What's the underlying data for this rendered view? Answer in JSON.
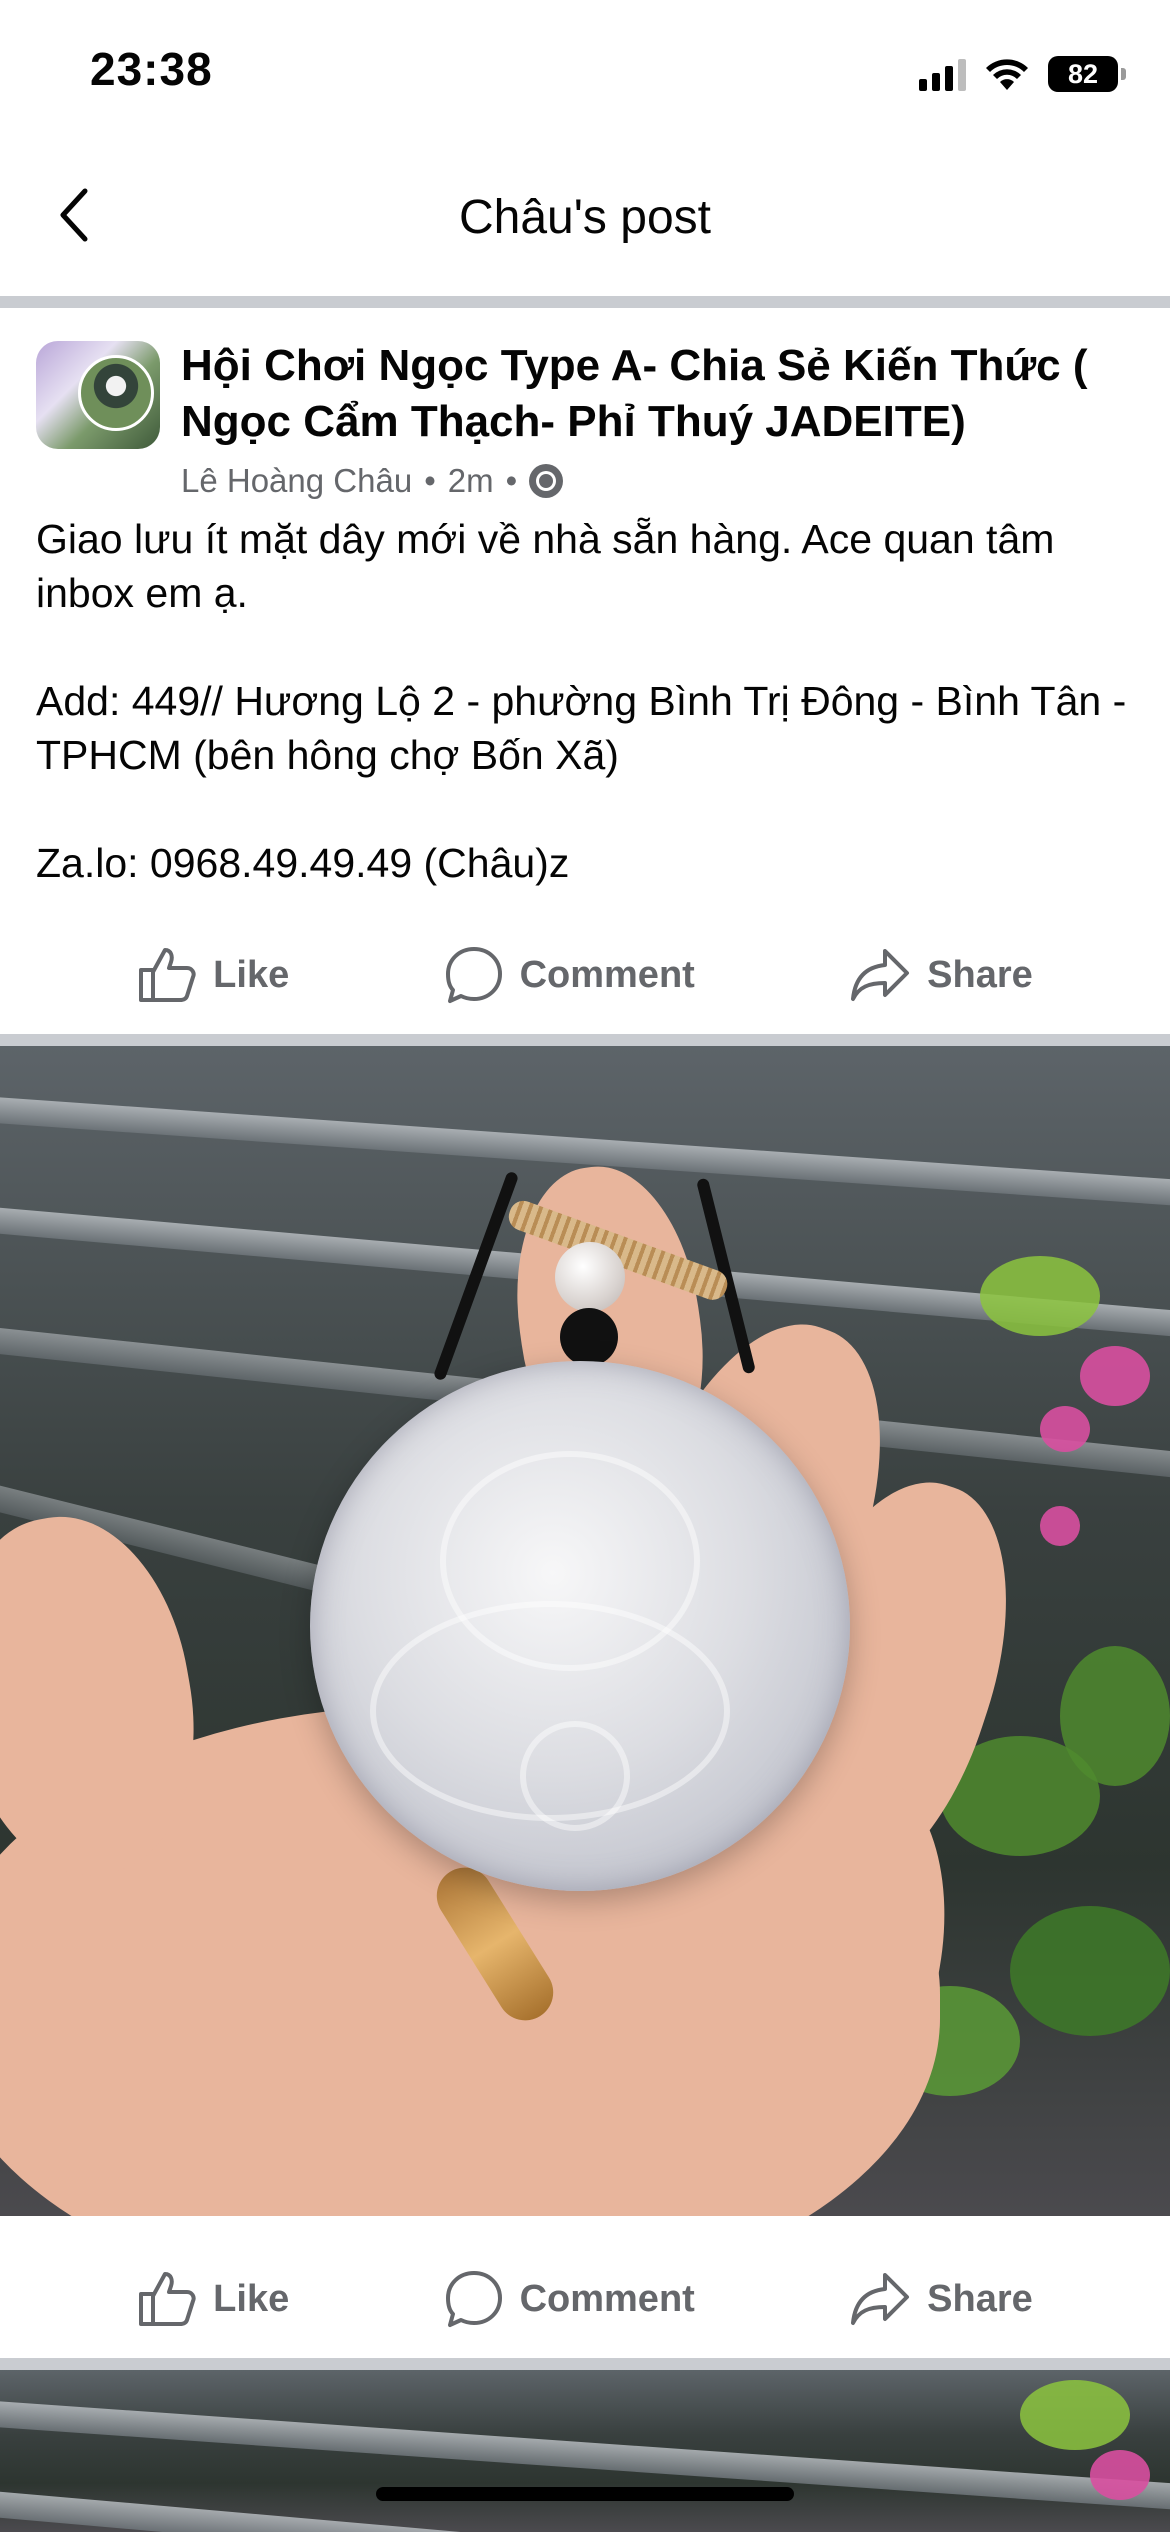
{
  "status_bar": {
    "time": "23:38",
    "battery": "82",
    "icons": [
      "signal-icon",
      "wifi-icon",
      "battery-icon"
    ]
  },
  "nav": {
    "title": "Châu's post",
    "back_icon": "chevron-left-icon"
  },
  "post": {
    "group_name": "Hội Chơi Ngọc Type A- Chia Sẻ Kiến Thức ( Ngọc Cẩm Thạch- Phỉ Thuý JADEITE)",
    "author": "Lê Hoàng Châu",
    "separator": "•",
    "time_ago": "2m",
    "privacy_icon": "globe-icon",
    "body": "Giao lưu ít mặt dây mới về nhà sẵn hàng. Ace quan tâm inbox em ạ.\n\nAdd: 449// Hương Lộ 2 - phường Bình Trị Đông - Bình Tân - TPHCM (bên hông chợ Bốn Xã)\n\nZa.lo: 0968.49.49.49 (Châu)z"
  },
  "actions": {
    "like": "Like",
    "comment": "Comment",
    "share": "Share"
  },
  "colors": {
    "text": "#050505",
    "secondary": "#65676b",
    "divider": "#c9ccd1"
  }
}
